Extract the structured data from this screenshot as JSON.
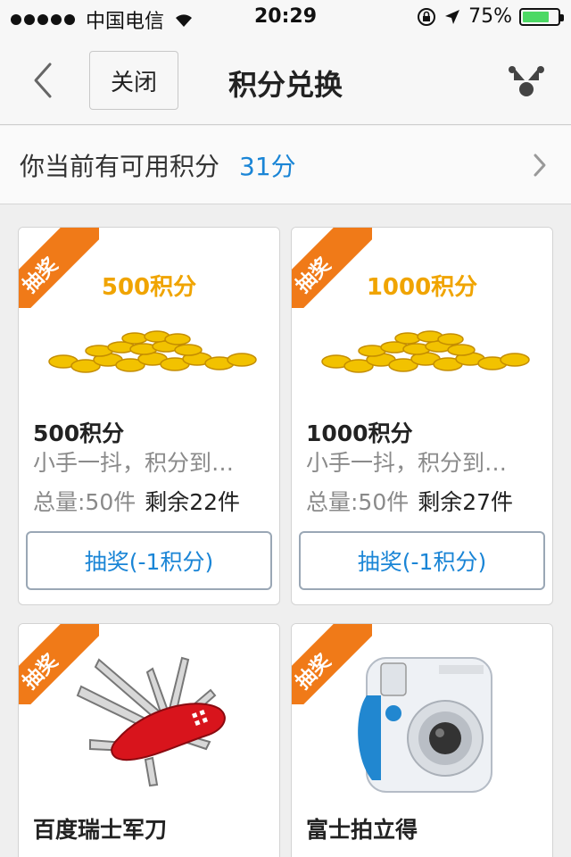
{
  "status_bar": {
    "carrier": "中国电信",
    "time": "20:29",
    "battery_percent": "75%",
    "battery_level": 0.75,
    "icons": [
      "signal-dots",
      "wifi-icon",
      "rotation-lock-icon",
      "location-arrow-icon",
      "battery-icon"
    ]
  },
  "nav": {
    "back_icon": "chevron-left-icon",
    "close_label": "关闭",
    "title": "积分兑换",
    "share_icon": "share-icon"
  },
  "points": {
    "label": "你当前有可用积分",
    "value": "31分",
    "chevron_icon": "chevron-right-icon"
  },
  "colors": {
    "accent": "#1a85d6",
    "ribbon": "#f07a18",
    "coin": "#f0a400"
  },
  "items": [
    {
      "ribbon": "抽奖",
      "image_text": "500积分",
      "image_type": "coins",
      "title": "500积分",
      "desc": "小手一抖，积分到…",
      "total": "总量:50件",
      "remaining": "剩余22件",
      "button": "抽奖(-1积分)"
    },
    {
      "ribbon": "抽奖",
      "image_text": "1000积分",
      "image_type": "coins",
      "title": "1000积分",
      "desc": "小手一抖，积分到…",
      "total": "总量:50件",
      "remaining": "剩余27件",
      "button": "抽奖(-1积分)"
    },
    {
      "ribbon": "抽奖",
      "image_type": "swiss-knife",
      "title": "百度瑞士军刀"
    },
    {
      "ribbon": "抽奖",
      "image_type": "instant-camera",
      "title": "富士拍立得"
    }
  ]
}
